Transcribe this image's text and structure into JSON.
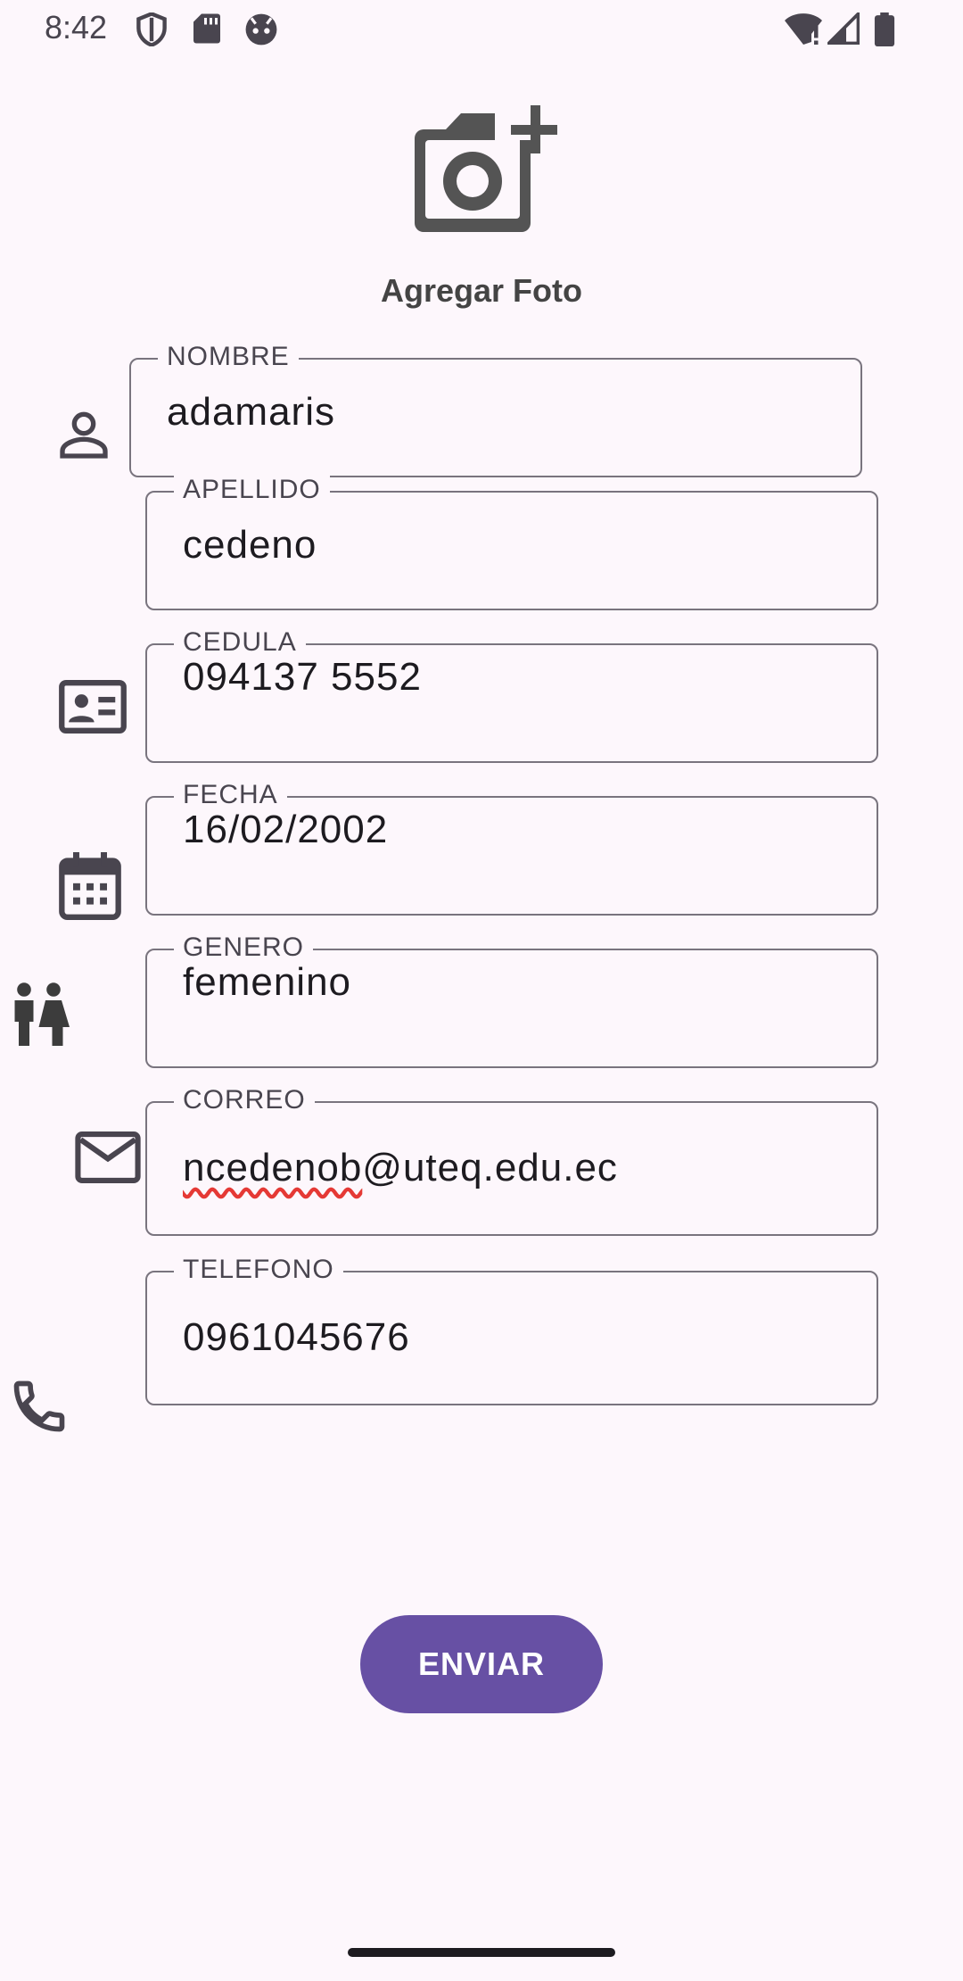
{
  "status_bar": {
    "time": "8:42",
    "icons": [
      "shield-icon",
      "sd-card-icon",
      "android-face-icon",
      "wifi-alert-icon",
      "signal-icon",
      "battery-icon"
    ]
  },
  "photo": {
    "icon": "add-camera-icon",
    "label": "Agregar Foto"
  },
  "form": {
    "nombre": {
      "label": "NOMBRE",
      "value": "adamaris"
    },
    "apellido": {
      "label": "APELLIDO",
      "value": "cedeno"
    },
    "cedula": {
      "label": "CEDULA",
      "value": "094137 5552"
    },
    "fecha": {
      "label": "FECHA",
      "value": "16/02/2002"
    },
    "genero": {
      "label": "GENERO",
      "value": "femenino"
    },
    "correo": {
      "label": "CORREO",
      "value_prefix": "ncedenob",
      "value_suffix": "@uteq.edu.ec"
    },
    "telefono": {
      "label": "TELEFONO",
      "value": "0961045676"
    }
  },
  "submit_label": "ENVIAR",
  "colors": {
    "background": "#fdf7fc",
    "primary": "#6750a4",
    "outline": "#79747e",
    "icon": "#49454f"
  }
}
